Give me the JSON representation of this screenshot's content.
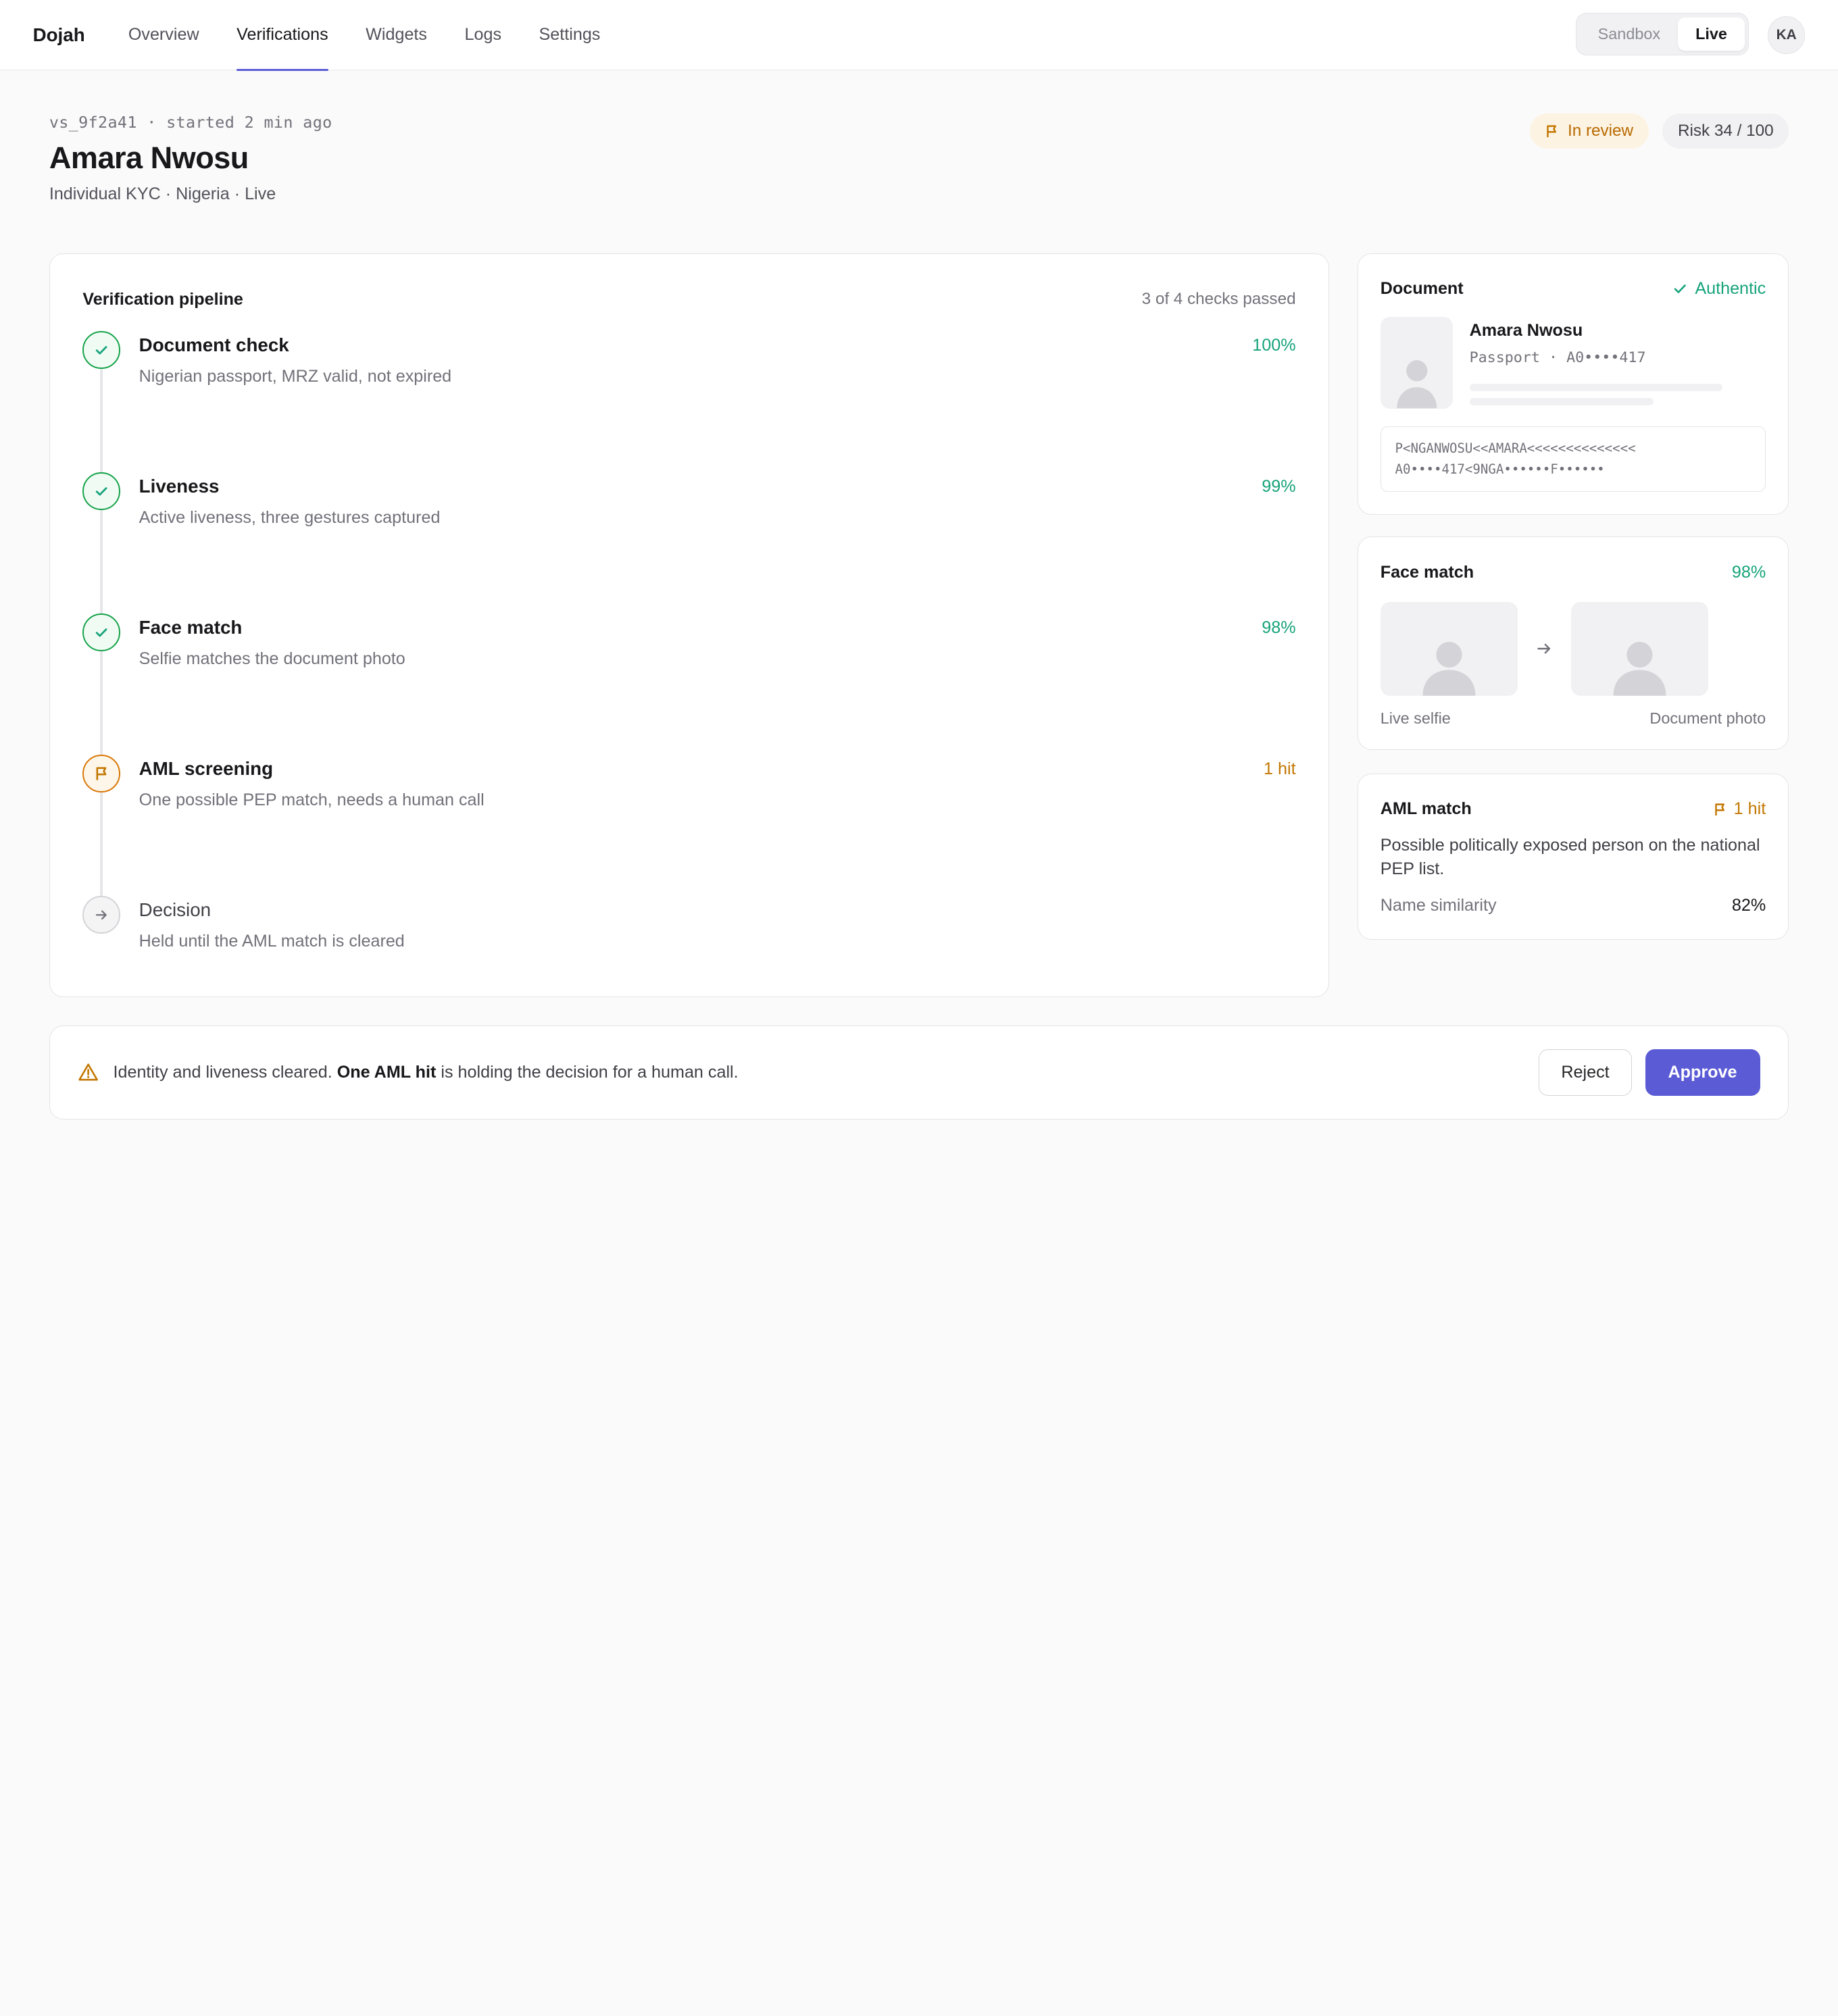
{
  "nav": {
    "brand": "Dojah",
    "items": [
      {
        "label": "Overview",
        "active": false
      },
      {
        "label": "Verifications",
        "active": true
      },
      {
        "label": "Widgets",
        "active": false
      },
      {
        "label": "Logs",
        "active": false
      },
      {
        "label": "Settings",
        "active": false
      }
    ],
    "env": {
      "sandbox": "Sandbox",
      "live": "Live",
      "selected": "Live"
    },
    "avatar_initials": "KA"
  },
  "header": {
    "session_meta": "vs_9f2a41 · started 2 min ago",
    "title": "Amara Nwosu",
    "subtitle": "Individual KYC · Nigeria · Live",
    "status_badge": "In review",
    "risk_badge": "Risk 34 / 100"
  },
  "pipeline": {
    "title": "Verification pipeline",
    "summary": "3 of 4 checks passed",
    "steps": [
      {
        "name": "Document check",
        "desc": "Nigerian passport, MRZ valid, not expired",
        "value": "100%",
        "state": "ok"
      },
      {
        "name": "Liveness",
        "desc": "Active liveness, three gestures captured",
        "value": "99%",
        "state": "ok"
      },
      {
        "name": "Face match",
        "desc": "Selfie matches the document photo",
        "value": "98%",
        "state": "ok"
      },
      {
        "name": "AML screening",
        "desc": "One possible PEP match, needs a human call",
        "value": "1 hit",
        "state": "warn"
      },
      {
        "name": "Decision",
        "desc": "Held until the AML match is cleared",
        "value": "",
        "state": "pending"
      }
    ]
  },
  "document": {
    "title": "Document",
    "status": "Authentic",
    "holder_name": "Amara Nwosu",
    "doc_meta": "Passport · A0••••417",
    "mrz_line1": "P<NGANWOSU<<AMARA<<<<<<<<<<<<<<",
    "mrz_line2": "A0••••417<9NGA••••••F••••••"
  },
  "face_match": {
    "title": "Face match",
    "score": "98%",
    "left_label": "Live selfie",
    "right_label": "Document photo"
  },
  "aml": {
    "title": "AML match",
    "hits": "1 hit",
    "description": "Possible politically exposed person on the national PEP list.",
    "similarity_label": "Name similarity",
    "similarity_value": "82%"
  },
  "action_bar": {
    "msg_prefix": "Identity and liveness cleared.",
    "msg_bold": "One AML hit",
    "msg_suffix": "is holding the decision for a human call.",
    "reject_label": "Reject",
    "approve_label": "Approve"
  },
  "colors": {
    "accent": "#5b5bd6",
    "success": "#16a37a",
    "warning": "#c27700"
  }
}
